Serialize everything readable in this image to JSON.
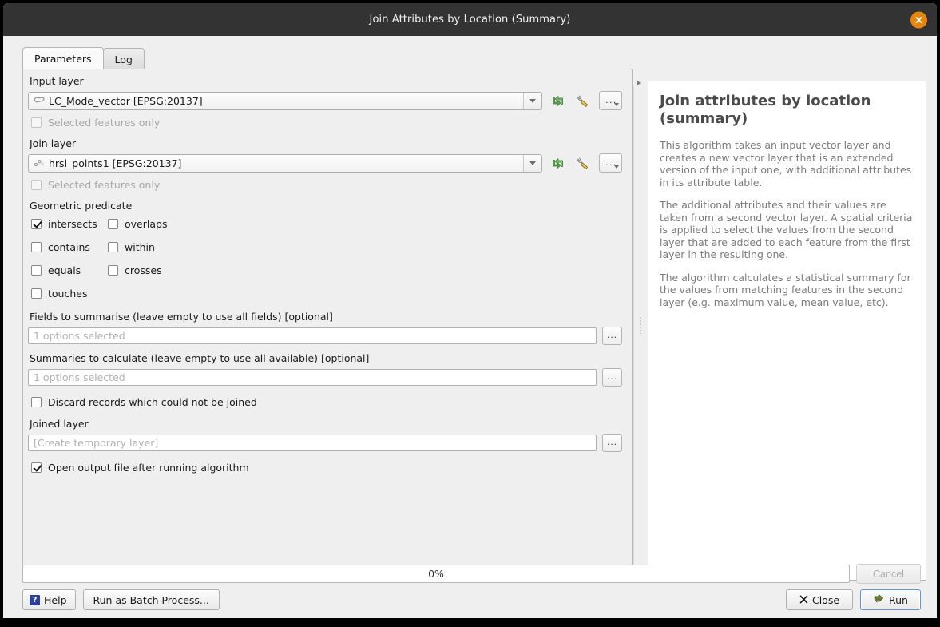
{
  "window": {
    "title": "Join Attributes by Location (Summary)",
    "close_icon": "close-icon"
  },
  "tabs": [
    {
      "label": "Parameters",
      "active": true
    },
    {
      "label": "Log",
      "active": false
    }
  ],
  "parameters": {
    "input_layer": {
      "label": "Input layer",
      "value": "LC_Mode_vector [EPSG:20137]",
      "icon": "polygon-layer-icon",
      "refresh_icon": "refresh-icon",
      "wrench_icon": "wrench-icon",
      "more_label": "...",
      "selected_features_only": {
        "label": "Selected features only",
        "checked": false,
        "enabled": false
      }
    },
    "join_layer": {
      "label": "Join layer",
      "value": "hrsl_points1 [EPSG:20137]",
      "icon": "point-layer-icon",
      "refresh_icon": "refresh-icon",
      "wrench_icon": "wrench-icon",
      "more_label": "...",
      "selected_features_only": {
        "label": "Selected features only",
        "checked": false,
        "enabled": false
      }
    },
    "geometric_predicate": {
      "label": "Geometric predicate",
      "options": [
        {
          "label": "intersects",
          "checked": true
        },
        {
          "label": "overlaps",
          "checked": false
        },
        {
          "label": "contains",
          "checked": false
        },
        {
          "label": "within",
          "checked": false
        },
        {
          "label": "equals",
          "checked": false
        },
        {
          "label": "crosses",
          "checked": false
        },
        {
          "label": "touches",
          "checked": false
        }
      ]
    },
    "fields_to_summarise": {
      "label": "Fields to summarise (leave empty to use all fields) [optional]",
      "placeholder": "1 options selected",
      "value": "",
      "more_label": "..."
    },
    "summaries_to_calculate": {
      "label": "Summaries to calculate (leave empty to use all available) [optional]",
      "placeholder": "1 options selected",
      "value": "",
      "more_label": "..."
    },
    "discard_records": {
      "label": "Discard records which could not be joined",
      "checked": false
    },
    "joined_layer": {
      "label": "Joined layer",
      "placeholder": "[Create temporary layer]",
      "value": "",
      "more_label": "..."
    },
    "open_output": {
      "label": "Open output file after running algorithm",
      "checked": true
    }
  },
  "help": {
    "title": "Join attributes by location (summary)",
    "paragraphs": [
      "This algorithm takes an input vector layer and creates a new vector layer that is an extended version of the input one, with additional attributes in its attribute table.",
      "The additional attributes and their values are taken from a second vector layer. A spatial criteria is applied to select the values from the second layer that are added to each feature from the first layer in the resulting one.",
      "The algorithm calculates a statistical summary for the values from matching features in the second layer (e.g. maximum value, mean value, etc)."
    ]
  },
  "footer": {
    "progress_text": "0%",
    "progress_percent": 0,
    "cancel_label": "Cancel",
    "help_label": "Help",
    "help_icon_glyph": "?",
    "batch_label": "Run as Batch Process...",
    "close_label": "Close",
    "close_icon": "x-icon",
    "run_label": "Run",
    "run_icon": "run-arrow-icon"
  },
  "colors": {
    "titlebar": "#333333",
    "close_button": "#e8860c",
    "dialog_bg": "#efefef",
    "help_bg": "#ffffff",
    "accent_blue": "#5b97d8",
    "help_icon_blue": "#2b3f9e",
    "refresh_green": "#5ea352",
    "run_green": "#6f7f3b"
  }
}
